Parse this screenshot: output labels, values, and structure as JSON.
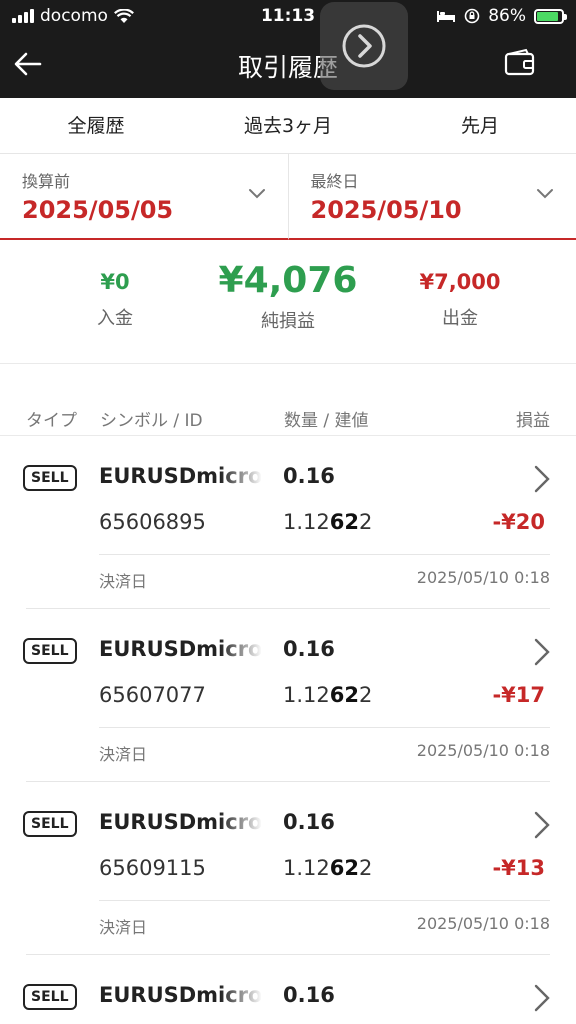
{
  "status": {
    "carrier": "docomo",
    "time": "11:13",
    "battery": "86%"
  },
  "header": {
    "title": "取引履歴"
  },
  "tabs": [
    {
      "label": "全履歴"
    },
    {
      "label": "過去3ヶ月"
    },
    {
      "label": "先月"
    }
  ],
  "dates": {
    "start": {
      "label": "換算前",
      "value": "2025/05/05"
    },
    "end": {
      "label": "最終日",
      "value": "2025/05/10"
    }
  },
  "summary": {
    "deposit": {
      "amount": "¥0",
      "label": "入金"
    },
    "net": {
      "amount": "¥4,076",
      "label": "純損益"
    },
    "withdrawal": {
      "amount": "¥7,000",
      "label": "出金"
    }
  },
  "columns": {
    "type": "タイプ",
    "symbol": "シンボル / ID",
    "volume": "数量 / 建値",
    "pnl": "損益"
  },
  "trades": [
    {
      "type": "SELL",
      "symbol": "EURUSDmicro",
      "lot": "0.16",
      "id": "65606895",
      "price_a": "1.12",
      "price_b": "62",
      "price_c": "2",
      "pnl": "-¥20",
      "settle_label": "決済日",
      "settle_date": "2025/05/10 0:18"
    },
    {
      "type": "SELL",
      "symbol": "EURUSDmicro",
      "lot": "0.16",
      "id": "65607077",
      "price_a": "1.12",
      "price_b": "62",
      "price_c": "2",
      "pnl": "-¥17",
      "settle_label": "決済日",
      "settle_date": "2025/05/10 0:18"
    },
    {
      "type": "SELL",
      "symbol": "EURUSDmicro",
      "lot": "0.16",
      "id": "65609115",
      "price_a": "1.12",
      "price_b": "62",
      "price_c": "2",
      "pnl": "-¥13",
      "settle_label": "決済日",
      "settle_date": "2025/05/10 0:18"
    },
    {
      "type": "SELL",
      "symbol": "EURUSDmicro",
      "lot": "0.16"
    }
  ],
  "icons": {
    "back": "arrow-left-icon",
    "wallet": "wallet-icon",
    "overlay": "chevron-right-icon",
    "dropdown": "chevron-down-icon",
    "row": "chevron-right-icon"
  },
  "colors": {
    "accent_red": "#c62828",
    "profit_green": "#2e9e4f",
    "header_bg": "#1b1b1b"
  }
}
